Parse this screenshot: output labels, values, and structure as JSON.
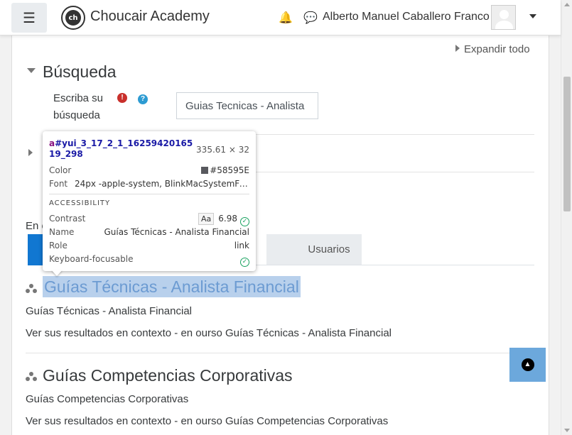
{
  "header": {
    "site_name": "Choucair Academy",
    "logo_text": "ch",
    "user_name": "Alberto Manuel Caballero Franco"
  },
  "page": {
    "expand_all": "Expandir todo",
    "section_title": "Búsqueda",
    "search_label": "Escriba su búsqueda",
    "search_value": "Guias Tecnicas - Analista",
    "partial_text": "En e",
    "tab_users": "Usuarios"
  },
  "results": [
    {
      "title": "Guías Técnicas - Analista Financial",
      "subtitle": "Guías Técnicas - Analista Financial",
      "context": "Ver sus resultados en contexto - en ourso Guías Técnicas - Analista Financial"
    },
    {
      "title": "Guías Competencias Corporativas",
      "subtitle": "Guías Competencias Corporativas",
      "context": "Ver sus resultados en contexto - en ourso Guías Competencias Corporativas"
    }
  ],
  "devtools_tooltip": {
    "selector_tag": "a",
    "selector_id": "#yui_3_17_2_1_1625942016519_298",
    "size": "335.61 × 32",
    "color_label": "Color",
    "color_value": "#58595E",
    "font_label": "Font",
    "font_value": "24px -apple-system, BlinkMacSystemFon…",
    "accessibility_heading": "ACCESSIBILITY",
    "contrast_label": "Contrast",
    "contrast_aa": "Aa",
    "contrast_value": "6.98",
    "name_label": "Name",
    "name_value": "Guías Técnicas - Analista Financial",
    "role_label": "Role",
    "role_value": "link",
    "focus_label": "Keyboard-focusable"
  },
  "colors": {
    "primary_tab": "#1177d1",
    "highlight": "#b8d0ec",
    "back_to_top": "#6ca8dc"
  }
}
